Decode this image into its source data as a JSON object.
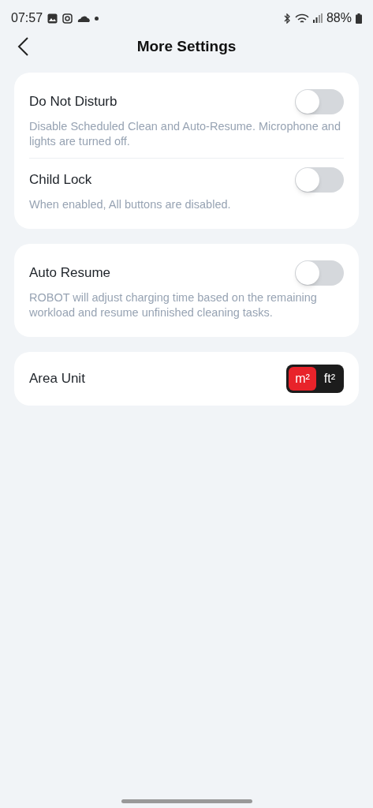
{
  "status_bar": {
    "time": "07:57",
    "battery": "88%"
  },
  "header": {
    "title": "More Settings"
  },
  "cards": [
    {
      "items": [
        {
          "kind": "toggle",
          "label": "Do Not Disturb",
          "on": false,
          "description": "Disable Scheduled Clean and Auto-Resume. Microphone and lights are turned off."
        },
        {
          "kind": "toggle",
          "label": "Child Lock",
          "on": false,
          "description": "When enabled, All buttons are disabled."
        }
      ]
    },
    {
      "items": [
        {
          "kind": "toggle",
          "label": "Auto Resume",
          "on": false,
          "description": "ROBOT will adjust charging time based on the remaining workload and resume unfinished cleaning tasks."
        }
      ]
    },
    {
      "items": [
        {
          "kind": "unit",
          "label": "Area Unit",
          "options": [
            {
              "label": "m²",
              "selected": true
            },
            {
              "label": "ft²",
              "selected": false
            }
          ]
        }
      ]
    }
  ]
}
